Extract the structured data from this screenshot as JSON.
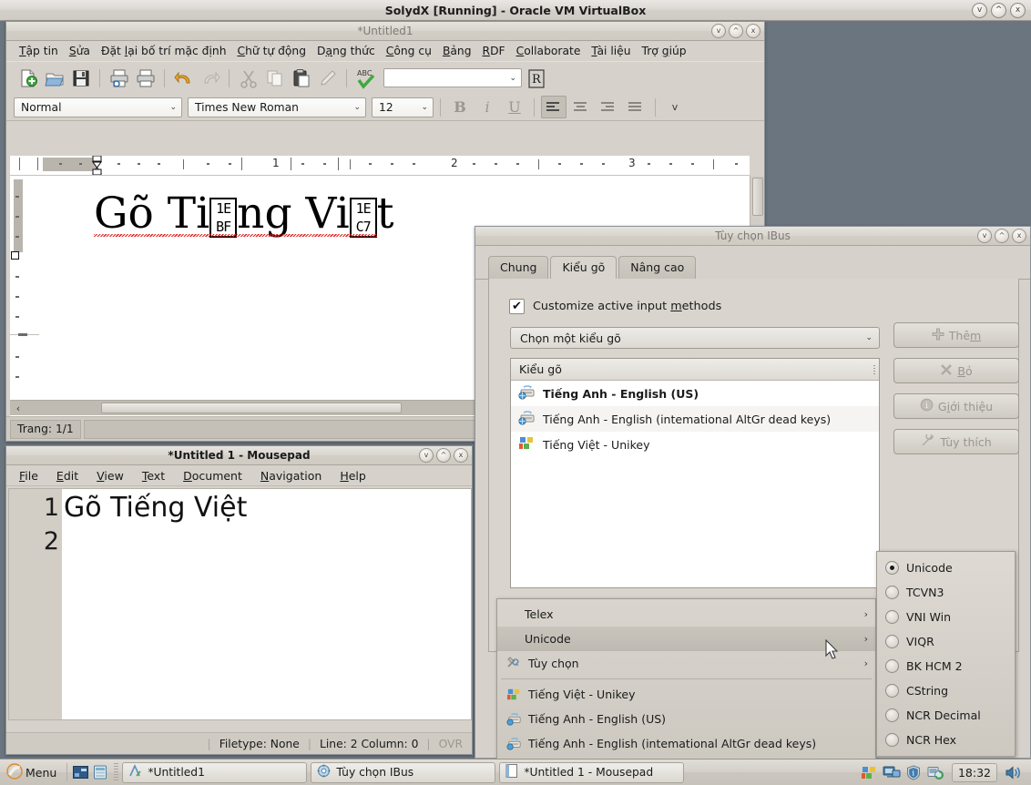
{
  "vbox": {
    "title": "SolydX [Running] - Oracle VM VirtualBox",
    "buttons": {
      "minimize": "v",
      "maximize": "^",
      "close": "x"
    }
  },
  "writer": {
    "title": "*Untitled1",
    "menus": [
      {
        "label": "Tập tin",
        "accel": "T"
      },
      {
        "label": "Sửa",
        "accel": "S"
      },
      {
        "label": "Đặt lại bố trí mặc định",
        "accel": "l"
      },
      {
        "label": "Chữ tự động",
        "accel": "C"
      },
      {
        "label": "Dạng thức",
        "accel": "a"
      },
      {
        "label": "Công cụ",
        "accel": "C"
      },
      {
        "label": "Bảng",
        "accel": "B"
      },
      {
        "label": "RDF",
        "accel": "R"
      },
      {
        "label": "Collaborate",
        "accel": "C"
      },
      {
        "label": "Tài liệu",
        "accel": "T"
      },
      {
        "label": "Trợ giúp",
        "accel": "g"
      }
    ],
    "toolbar_icons": [
      "new-document-icon",
      "open-folder-icon",
      "save-icon",
      "print-preview-icon",
      "print-icon",
      "undo-icon",
      "redo-icon",
      "cut-icon",
      "copy-icon",
      "paste-icon",
      "format-paintbrush-icon",
      "spellcheck-icon"
    ],
    "toolbar_combo_value": "",
    "rdf_button": "R",
    "style_value": "Normal",
    "font_value": "Times New Roman",
    "size_value": "12",
    "format_buttons": [
      "bold",
      "italic",
      "underline",
      "align-left",
      "align-center",
      "align-right",
      "align-justify"
    ],
    "overflow_chevron": "v",
    "ruler": {
      "numbers": [
        "1",
        "2",
        "3"
      ],
      "unit_marks": 3
    },
    "document_text": {
      "prefix": "Gõ Ti",
      "missing_1_top": "1E",
      "missing_1_bottom": "BF",
      "middle": "ng Vi",
      "missing_2_top": "1E",
      "missing_2_bottom": "C7",
      "suffix": "t",
      "plain": "Gõ Tiếng Việt"
    },
    "status": {
      "page": "Trang: 1/1"
    },
    "window_buttons": {
      "minimize": "v",
      "maximize": "^",
      "close": "x"
    }
  },
  "mousepad": {
    "title": "*Untitled 1 - Mousepad",
    "menus": [
      {
        "label": "File",
        "accel": "F"
      },
      {
        "label": "Edit",
        "accel": "E"
      },
      {
        "label": "View",
        "accel": "V"
      },
      {
        "label": "Text",
        "accel": "T"
      },
      {
        "label": "Document",
        "accel": "D"
      },
      {
        "label": "Navigation",
        "accel": "N"
      },
      {
        "label": "Help",
        "accel": "H"
      }
    ],
    "line_numbers": [
      "1",
      "2"
    ],
    "content": "Gõ Tiếng Việt",
    "status": {
      "filetype": "Filetype: None",
      "position": "Line: 2 Column: 0",
      "mode": "OVR"
    },
    "window_buttons": {
      "minimize": "v",
      "maximize": "^",
      "close": "x"
    }
  },
  "ibus": {
    "title": "Tùy chọn IBus",
    "tabs": [
      {
        "label": "Chung",
        "active": false
      },
      {
        "label": "Kiểu gõ",
        "active": true
      },
      {
        "label": "Nâng cao",
        "active": false
      }
    ],
    "checkbox": {
      "label": "Customize active input methods",
      "checked": true,
      "accel": "m"
    },
    "combo_value": "Chọn một kiểu gõ",
    "list_header": "Kiểu gõ",
    "list_items": [
      {
        "label": "Tiếng Anh - English (US)",
        "icon": "keyboard-globe-icon",
        "selected": true
      },
      {
        "label": "Tiếng Anh - English (intemational AltGr dead keys)",
        "icon": "keyboard-globe-icon",
        "selected": false
      },
      {
        "label": "Tiếng Việt - Unikey",
        "icon": "unikey-icon",
        "selected": false
      }
    ],
    "buttons": [
      {
        "label": "Thêm",
        "accel": "m",
        "icon": "plus-icon"
      },
      {
        "label": "Bỏ",
        "accel": "B",
        "icon": "cross-icon"
      },
      {
        "label": "Giới thiệu",
        "accel": "i",
        "icon": "info-icon"
      },
      {
        "label": "Tùy thích",
        "accel": "",
        "icon": "wrench-icon"
      }
    ],
    "window_buttons": {
      "minimize": "v",
      "maximize": "^",
      "close": "x"
    }
  },
  "context_menu": {
    "items": [
      {
        "label": "Telex",
        "icon": "",
        "submenu": true,
        "highlighted": false
      },
      {
        "label": "Unicode",
        "icon": "",
        "submenu": true,
        "highlighted": true
      },
      {
        "label": "Tùy chọn",
        "icon": "tools-icon",
        "submenu": true,
        "highlighted": false
      },
      {
        "separator": true
      },
      {
        "label": "Tiếng Việt - Unikey",
        "icon": "unikey-icon",
        "submenu": false,
        "highlighted": false
      },
      {
        "label": "Tiếng Anh - English (US)",
        "icon": "keyboard-globe-icon",
        "submenu": false,
        "highlighted": false
      },
      {
        "label": "Tiếng Anh - English (intemational AltGr dead keys)",
        "icon": "keyboard-globe-icon",
        "submenu": false,
        "highlighted": false
      }
    ],
    "arrow_glyph": "›"
  },
  "submenu": {
    "items": [
      {
        "label": "Unicode",
        "checked": true
      },
      {
        "label": "TCVN3",
        "checked": false
      },
      {
        "label": "VNI Win",
        "checked": false
      },
      {
        "label": "VIQR",
        "checked": false
      },
      {
        "label": "BK HCM 2",
        "checked": false
      },
      {
        "label": "CString",
        "checked": false
      },
      {
        "label": "NCR Decimal",
        "checked": false
      },
      {
        "label": "NCR Hex",
        "checked": false
      }
    ]
  },
  "taskbar": {
    "menu_label": "Menu",
    "quick_icons": [
      "show-desktop-icon",
      "file-manager-icon"
    ],
    "tasks": [
      {
        "label": "*Untitled1",
        "icon": "writer-icon"
      },
      {
        "label": "Tùy chọn IBus",
        "icon": "ibus-gear-icon"
      },
      {
        "label": "*Untitled 1 - Mousepad",
        "icon": "mousepad-icon"
      }
    ],
    "tray_icons": [
      "unikey-tray-icon",
      "network-icon",
      "shield-icon",
      "updates-icon"
    ],
    "clock": "18:32",
    "volume_icon": "volume-icon"
  },
  "colors": {
    "desktop": "#6b757f",
    "chrome": "#d6d2cb",
    "highlight": "#c9c5bd",
    "spell_error": "#e02020"
  }
}
